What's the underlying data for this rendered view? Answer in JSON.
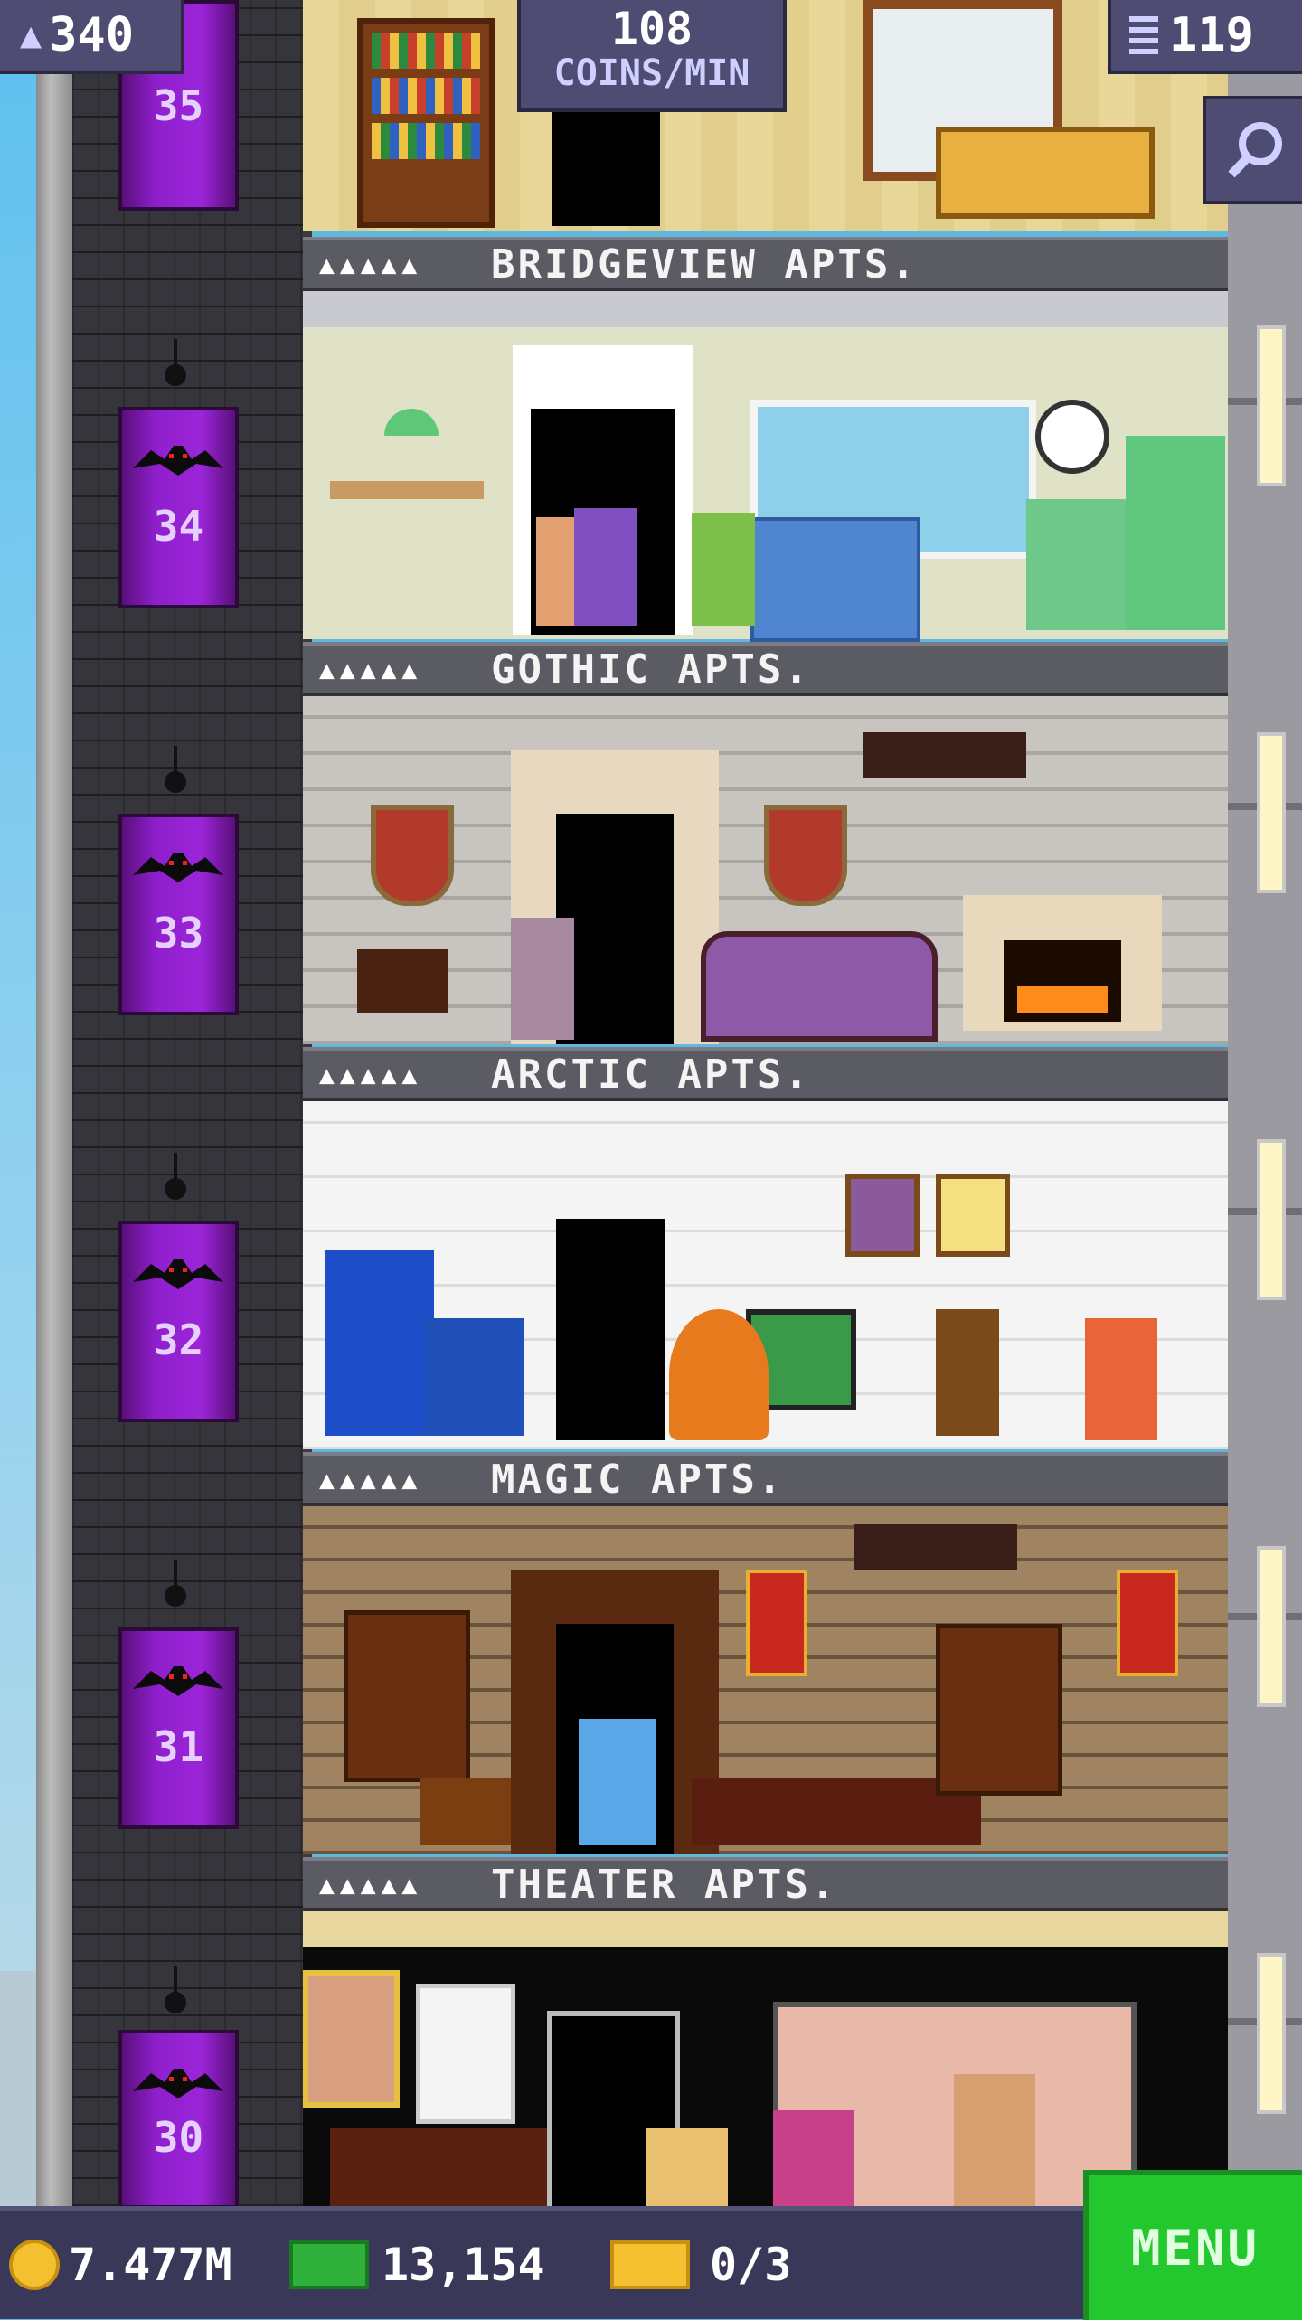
{
  "hud": {
    "population": "340",
    "coins_per_min_value": "108",
    "coins_per_min_label": "COINS/MIN",
    "floors": "119"
  },
  "floors": [
    {
      "number": "35",
      "name": "",
      "theme": "residential"
    },
    {
      "number": "34",
      "name": "BRIDGEVIEW APTS.",
      "stars": "▲▲▲▲▲"
    },
    {
      "number": "33",
      "name": "GOTHIC APTS.",
      "stars": "▲▲▲▲▲"
    },
    {
      "number": "32",
      "name": "ARCTIC APTS.",
      "stars": "▲▲▲▲▲"
    },
    {
      "number": "31",
      "name": "MAGIC APTS.",
      "stars": "▲▲▲▲▲"
    },
    {
      "number": "30",
      "name": "THEATER APTS.",
      "stars": "▲▲▲▲▲"
    }
  ],
  "bottom": {
    "coins": "7.477M",
    "bux": "13,154",
    "tickets": "0/3",
    "menu_label": "MENU"
  },
  "icons": {
    "population": "person-icon",
    "floors": "building-icon",
    "search": "magnifier-icon",
    "coin": "coin-icon",
    "bux": "banknote-icon",
    "ticket": "ticket-icon",
    "elevator_marker": "bat-icon"
  },
  "colors": {
    "hud_bg": "#4e4c72",
    "menu": "#22c82e",
    "elevator": "#9b25d8",
    "banner": "#5b5b63"
  }
}
